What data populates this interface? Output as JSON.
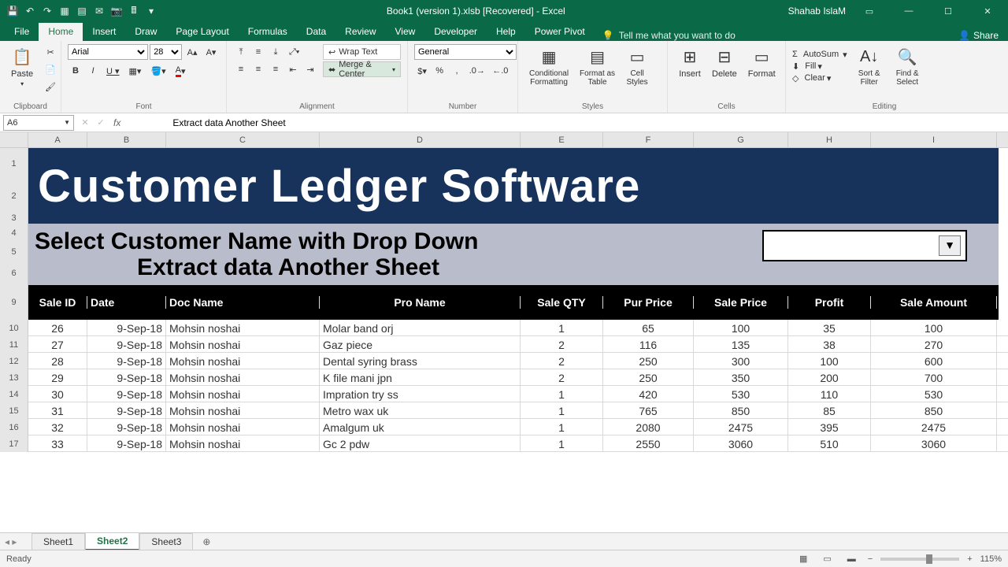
{
  "app": {
    "title": "Book1 (version 1).xlsb [Recovered] - Excel",
    "user": "Shahab IslaM",
    "share": "Share"
  },
  "tabs": [
    "File",
    "Home",
    "Insert",
    "Draw",
    "Page Layout",
    "Formulas",
    "Data",
    "Review",
    "View",
    "Developer",
    "Help",
    "Power Pivot"
  ],
  "tellme": "Tell me what you want to do",
  "ribbon": {
    "clipboard": {
      "label": "Clipboard",
      "paste": "Paste"
    },
    "font": {
      "label": "Font",
      "name": "Arial",
      "size": "28"
    },
    "alignment": {
      "label": "Alignment",
      "wrap": "Wrap Text",
      "merge": "Merge & Center"
    },
    "number": {
      "label": "Number",
      "format": "General"
    },
    "styles": {
      "label": "Styles",
      "cond": "Conditional\nFormatting",
      "table": "Format as\nTable",
      "cell": "Cell\nStyles"
    },
    "cells": {
      "label": "Cells",
      "insert": "Insert",
      "delete": "Delete",
      "format": "Format"
    },
    "editing": {
      "label": "Editing",
      "autosum": "AutoSum",
      "fill": "Fill",
      "clear": "Clear",
      "sort": "Sort &\nFilter",
      "find": "Find &\nSelect"
    }
  },
  "fbar": {
    "cell": "A6",
    "fx": "Extract data Another Sheet"
  },
  "cols": [
    "A",
    "B",
    "C",
    "D",
    "E",
    "F",
    "G",
    "H",
    "I"
  ],
  "rownums_top": [
    "1",
    "2",
    "3",
    "4",
    "5",
    "6"
  ],
  "banner": {
    "title": "Customer Ledger Software",
    "line1": "Select Customer Name with Drop Down",
    "line2": "Extract data Another Sheet"
  },
  "headers": [
    "Sale ID",
    "Date",
    "Doc Name",
    "Pro Name",
    "Sale QTY",
    "Pur Price",
    "Sale Price",
    "Profit",
    "Sale Amount"
  ],
  "header_row": "9",
  "rows": [
    {
      "n": "10",
      "d": [
        "26",
        "9-Sep-18",
        "Mohsin noshai",
        "Molar band orj",
        "1",
        "65",
        "100",
        "35",
        "100"
      ]
    },
    {
      "n": "11",
      "d": [
        "27",
        "9-Sep-18",
        "Mohsin noshai",
        "Gaz piece",
        "2",
        "116",
        "135",
        "38",
        "270"
      ]
    },
    {
      "n": "12",
      "d": [
        "28",
        "9-Sep-18",
        "Mohsin noshai",
        "Dental syring brass",
        "2",
        "250",
        "300",
        "100",
        "600"
      ]
    },
    {
      "n": "13",
      "d": [
        "29",
        "9-Sep-18",
        "Mohsin noshai",
        "K file mani jpn",
        "2",
        "250",
        "350",
        "200",
        "700"
      ]
    },
    {
      "n": "14",
      "d": [
        "30",
        "9-Sep-18",
        "Mohsin noshai",
        "Impration try ss",
        "1",
        "420",
        "530",
        "110",
        "530"
      ]
    },
    {
      "n": "15",
      "d": [
        "31",
        "9-Sep-18",
        "Mohsin noshai",
        "Metro wax uk",
        "1",
        "765",
        "850",
        "85",
        "850"
      ]
    },
    {
      "n": "16",
      "d": [
        "32",
        "9-Sep-18",
        "Mohsin noshai",
        "Amalgum uk",
        "1",
        "2080",
        "2475",
        "395",
        "2475"
      ]
    },
    {
      "n": "17",
      "d": [
        "33",
        "9-Sep-18",
        "Mohsin noshai",
        "Gc 2 pdw",
        "1",
        "2550",
        "3060",
        "510",
        "3060"
      ]
    }
  ],
  "sheets": [
    "Sheet1",
    "Sheet2",
    "Sheet3"
  ],
  "active_sheet": "Sheet2",
  "status": {
    "ready": "Ready",
    "zoom": "115%"
  }
}
